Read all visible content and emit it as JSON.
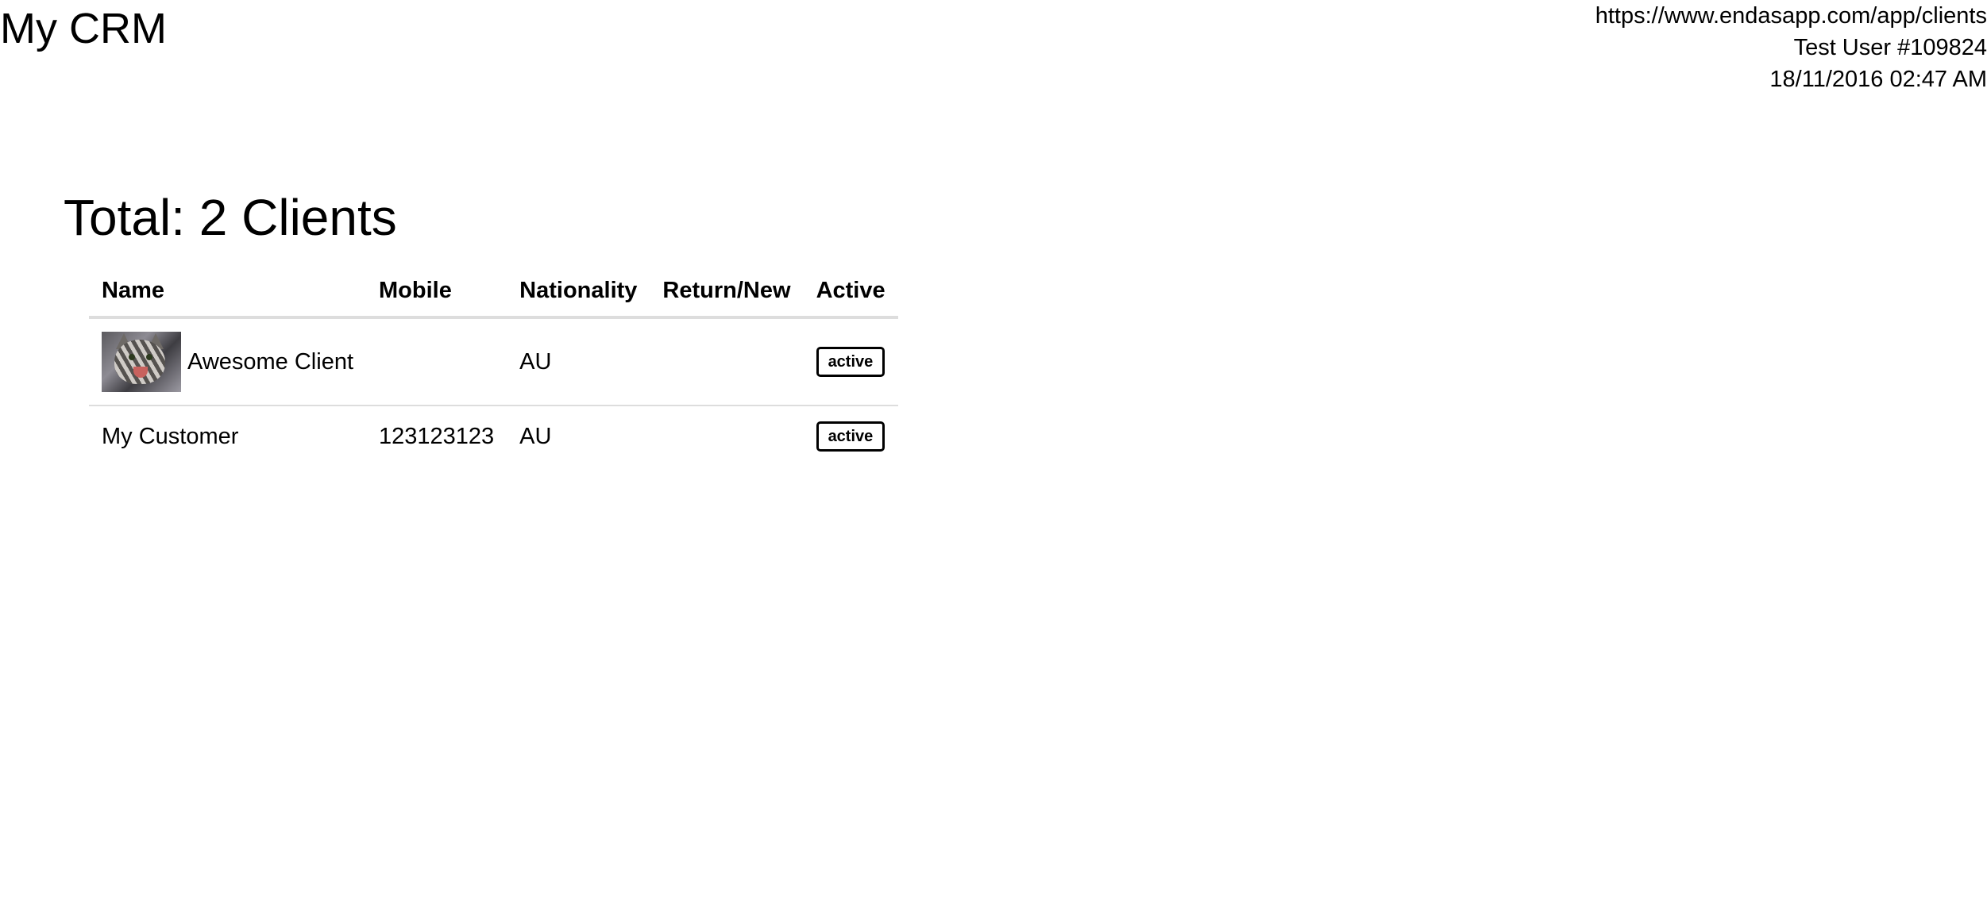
{
  "app": {
    "title": "My CRM"
  },
  "header": {
    "url": "https://www.endasapp.com/app/clients",
    "user": "Test User #109824",
    "datetime": "18/11/2016 02:47 AM"
  },
  "main": {
    "total_heading": "Total: 2 Clients"
  },
  "table": {
    "columns": [
      "Name",
      "Mobile",
      "Nationality",
      "Return/New",
      "Active"
    ],
    "rows": [
      {
        "avatar_icon": "cat-photo",
        "name": "Awesome Client",
        "mobile": "",
        "nationality": "AU",
        "return_new": "",
        "active": "active"
      },
      {
        "name": "My Customer",
        "mobile": "123123123",
        "nationality": "AU",
        "return_new": "",
        "active": "active"
      }
    ]
  }
}
